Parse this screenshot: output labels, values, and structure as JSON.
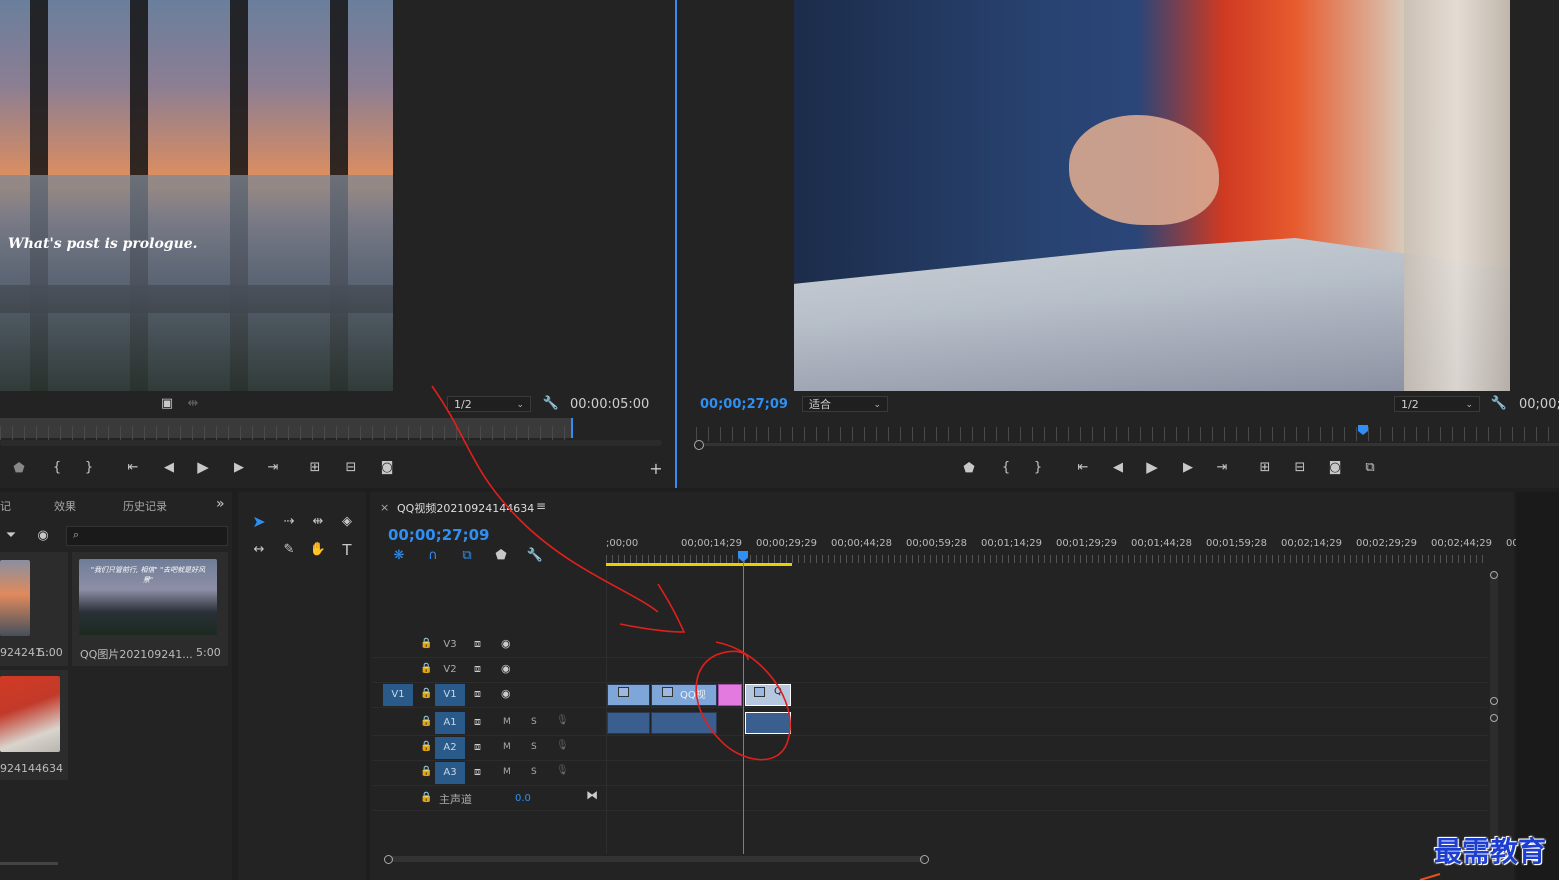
{
  "source_monitor": {
    "overlay_text": "What's past is prologue.",
    "zoom": "1/2",
    "duration": "00:00:05:00"
  },
  "program_monitor": {
    "timecode": "00;00;27;09",
    "fit": "适合",
    "zoom": "1/2",
    "duration": "00;00;"
  },
  "project_panel": {
    "tabs": [
      "记",
      "效果",
      "历史记录"
    ],
    "items": [
      {
        "name": "924241...",
        "duration": "5:00"
      },
      {
        "name": "QQ图片202109241...",
        "duration": "5:00"
      },
      {
        "name": "924144634",
        "duration": ""
      }
    ],
    "thumb_text": "\"我们只管前行, 相信\" \"去吧就是好风景\""
  },
  "timeline": {
    "sequence_name": "QQ视频20210924144634",
    "timecode": "00;00;27;09",
    "ruler_labels": [
      ";00;00",
      "00;00;14;29",
      "00;00;29;29",
      "00;00;44;28",
      "00;00;59;28",
      "00;01;14;29",
      "00;01;29;29",
      "00;01;44;28",
      "00;01;59;28",
      "00;02;14;29",
      "00;02;29;29",
      "00;02;44;29",
      "00"
    ],
    "tracks": [
      {
        "name": "V3",
        "type": "video"
      },
      {
        "name": "V2",
        "type": "video"
      },
      {
        "name": "V1",
        "type": "video",
        "target": "V1"
      },
      {
        "name": "A1",
        "type": "audio",
        "m": "M",
        "s": "S"
      },
      {
        "name": "A2",
        "type": "audio",
        "m": "M",
        "s": "S"
      },
      {
        "name": "A3",
        "type": "audio",
        "m": "M",
        "s": "S"
      }
    ],
    "master": {
      "label": "主声道",
      "value": "0.0"
    },
    "clip_label": "QQ视",
    "clip_label_short": "Q"
  },
  "watermark": "最需教育",
  "colors": {
    "accent": "#2f8ff2",
    "clip_blue": "#7ea6d8",
    "clip_pink": "#e37adf",
    "annotation": "#e0201c"
  }
}
